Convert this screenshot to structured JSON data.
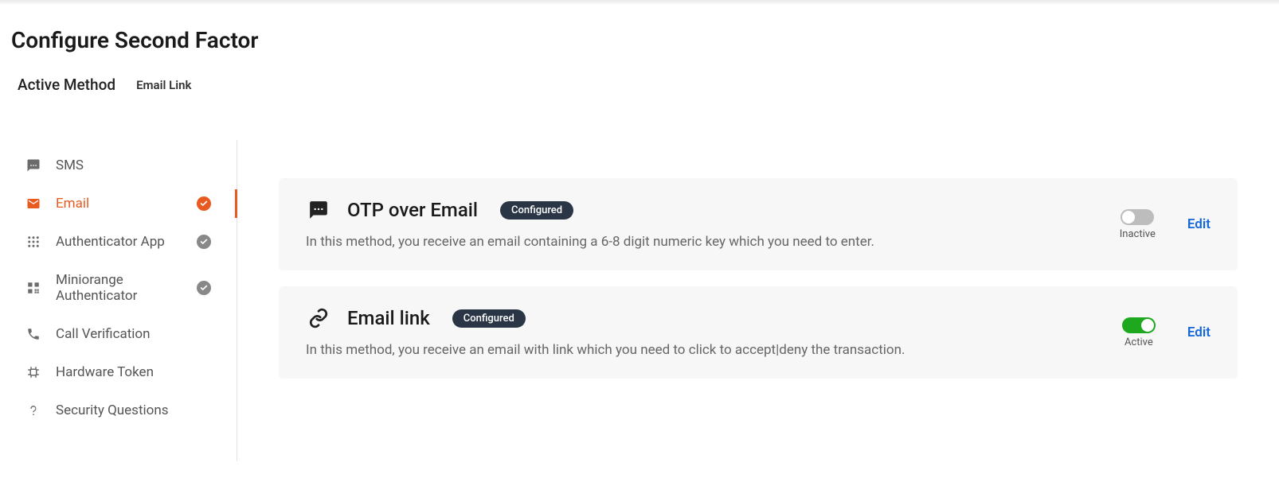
{
  "header": {
    "title": "Configure Second Factor",
    "active_method_label": "Active Method",
    "active_method_value": "Email Link"
  },
  "sidebar": {
    "items": [
      {
        "label": "SMS",
        "icon": "sms-icon",
        "checked": false,
        "active": false
      },
      {
        "label": "Email",
        "icon": "email-icon",
        "checked": true,
        "active": true
      },
      {
        "label": "Authenticator App",
        "icon": "grid-icon",
        "checked": true,
        "active": false
      },
      {
        "label": "Miniorange Authenticator",
        "icon": "qr-icon",
        "checked": true,
        "active": false
      },
      {
        "label": "Call Verification",
        "icon": "phone-icon",
        "checked": false,
        "active": false
      },
      {
        "label": "Hardware Token",
        "icon": "token-icon",
        "checked": false,
        "active": false
      },
      {
        "label": "Security Questions",
        "icon": "question-icon",
        "checked": false,
        "active": false
      }
    ]
  },
  "methods": [
    {
      "icon": "chat-icon",
      "title": "OTP over Email",
      "badge": "Configured",
      "description": "In this method, you receive an email containing a 6-8 digit numeric key which you need to enter.",
      "toggle_on": false,
      "toggle_label": "Inactive",
      "edit_label": "Edit"
    },
    {
      "icon": "link-icon",
      "title": "Email link",
      "badge": "Configured",
      "description": "In this method, you receive an email with link which you need to click to accept|deny the transaction.",
      "toggle_on": true,
      "toggle_label": "Active",
      "edit_label": "Edit"
    }
  ]
}
